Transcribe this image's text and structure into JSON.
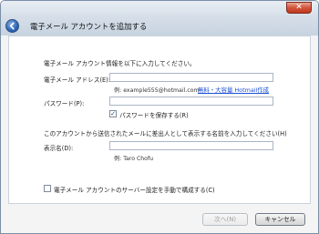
{
  "window": {
    "close_glyph": "✕",
    "title": "電子メール アカウントを追加する"
  },
  "form": {
    "instruction": "電子メール アカウント情報を以下に入力してください。",
    "email_label": "電子メール アドレス(E):",
    "email_value": "",
    "email_example": "例: example555@hotmail.com",
    "hotmail_link": "無料・大容量 Hotmail作成",
    "password_label": "パスワード(P):",
    "password_value": "",
    "save_password_label": "パスワードを保存する(R)",
    "save_password_checked": true,
    "display_name_instruction": "このアカウントから送信されたメールに差出人として表示する名前を入力してください(H)",
    "display_name_label": "表示名(D):",
    "display_name_value": "",
    "display_name_example": "例: Taro Chofu",
    "manual_config_label": "電子メール アカウントのサーバー設定を手動で構成する(C)",
    "manual_config_checked": false
  },
  "buttons": {
    "next_label": "次へ(N)",
    "cancel_label": "キャンセル"
  }
}
